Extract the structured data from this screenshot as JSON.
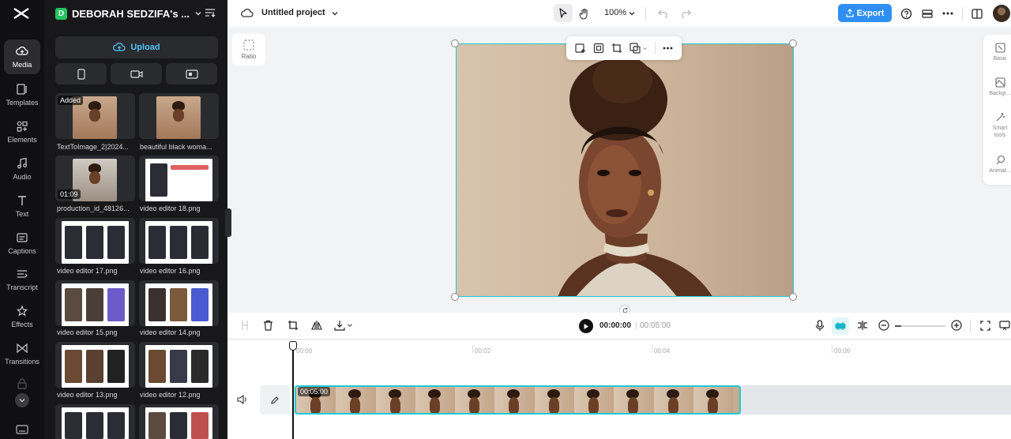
{
  "rail": {
    "items": [
      {
        "label": "Media",
        "icon": "cloud-icon"
      },
      {
        "label": "Templates",
        "icon": "templates-icon"
      },
      {
        "label": "Elements",
        "icon": "elements-icon"
      },
      {
        "label": "Audio",
        "icon": "music-note-icon"
      },
      {
        "label": "Text",
        "icon": "text-icon"
      },
      {
        "label": "Captions",
        "icon": "captions-icon"
      },
      {
        "label": "Transcript",
        "icon": "transcript-icon"
      },
      {
        "label": "Effects",
        "icon": "effects-icon"
      },
      {
        "label": "Transitions",
        "icon": "transitions-icon"
      }
    ]
  },
  "panel": {
    "workspace_initial": "D",
    "workspace_name": "DEBORAH SEDZIFA's ...",
    "upload_label": "Upload",
    "media": [
      {
        "caption": "TextToImage_2|2024...",
        "badge": "Added",
        "kind": "portrait"
      },
      {
        "caption": "beautiful black woma...",
        "kind": "portrait"
      },
      {
        "caption": "production_id_48126...",
        "badge": "01:09",
        "kind": "video"
      },
      {
        "caption": "video editor 18.png",
        "kind": "shot"
      },
      {
        "caption": "video editor 17.png",
        "kind": "shot-dark"
      },
      {
        "caption": "video editor 16.png",
        "kind": "shot-dark"
      },
      {
        "caption": "video editor 15.png",
        "kind": "shot"
      },
      {
        "caption": "video editor 14.png",
        "kind": "shot"
      },
      {
        "caption": "video editor 13.png",
        "kind": "shot"
      },
      {
        "caption": "video editor 12.png",
        "kind": "shot"
      }
    ]
  },
  "topbar": {
    "project_title": "Untitled project",
    "zoom": "100%",
    "export_label": "Export"
  },
  "canvas": {
    "ratio_label": "Ratio"
  },
  "right_panel": {
    "items": [
      "Basic",
      "Backgr...",
      "Smart tools",
      "Animat..."
    ]
  },
  "timeline": {
    "current_time": "00:00:00",
    "total_time": "00:05:00",
    "ruler": [
      "00:00",
      "00:02",
      "00:04",
      "00:06"
    ],
    "clip_duration": "00:05:00"
  },
  "colors": {
    "accent": "#20c8d8",
    "export": "#2f8ff2",
    "upload_text": "#4fc3f7"
  }
}
